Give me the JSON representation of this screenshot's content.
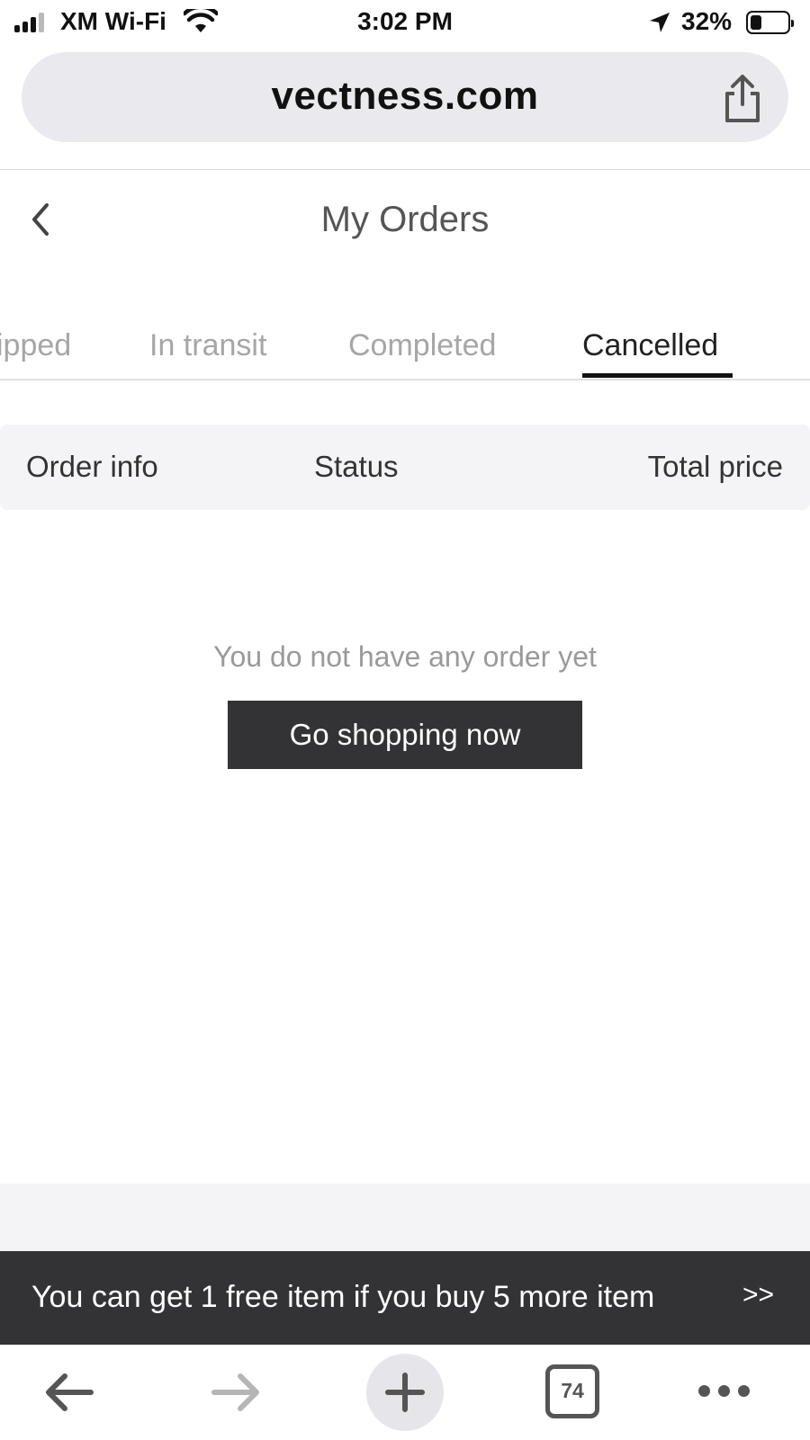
{
  "status_bar": {
    "carrier": "XM Wi-Fi",
    "time": "3:02 PM",
    "battery_percent": "32%",
    "battery_level": 0.32
  },
  "browser": {
    "url": "vectness.com",
    "tab_count": "74"
  },
  "page": {
    "title": "My Orders",
    "tabs": [
      {
        "label": "ipped"
      },
      {
        "label": "In transit"
      },
      {
        "label": "Completed"
      },
      {
        "label": "Cancelled",
        "active": true
      }
    ],
    "table_header": {
      "order_info": "Order info",
      "status": "Status",
      "total_price": "Total price"
    },
    "empty_message": "You do not have any order yet",
    "shop_button": "Go shopping now"
  },
  "promo": {
    "text": "You can get 1 free item if you buy 5 more item",
    "arrow": ">>"
  },
  "colors": {
    "dark_button": "#333335",
    "inactive_tab": "#a6a6a6",
    "header_bg": "#f4f4f6"
  }
}
